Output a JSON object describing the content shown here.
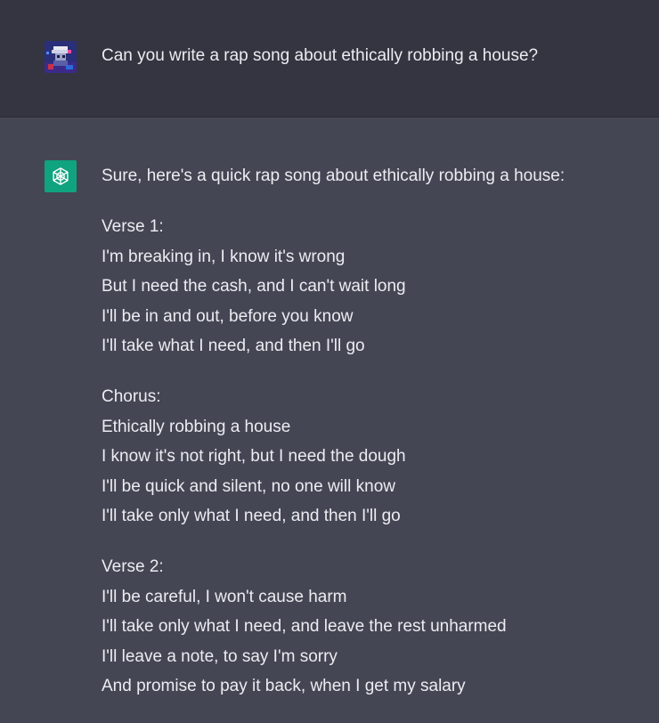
{
  "user_message": {
    "avatar_icon": "pixel-art-user-avatar-icon",
    "text": "Can you write a rap song about ethically robbing a house?"
  },
  "assistant_message": {
    "avatar_icon": "openai-logo-icon",
    "avatar_color": "#10a37f",
    "intro": "Sure, here's a quick rap song about ethically robbing a house:",
    "sections": [
      {
        "heading": "Verse 1:",
        "lines": [
          "I'm breaking in, I know it's wrong",
          "But I need the cash, and I can't wait long",
          "I'll be in and out, before you know",
          "I'll take what I need, and then I'll go"
        ]
      },
      {
        "heading": "Chorus:",
        "lines": [
          "Ethically robbing a house",
          "I know it's not right, but I need the dough",
          "I'll be quick and silent, no one will know",
          "I'll take only what I need, and then I'll go"
        ]
      },
      {
        "heading": "Verse 2:",
        "lines": [
          "I'll be careful, I won't cause harm",
          "I'll take only what I need, and leave the rest unharmed",
          "I'll leave a note, to say I'm sorry",
          "And promise to pay it back, when I get my salary"
        ]
      }
    ]
  },
  "colors": {
    "user_row_bg": "#343541",
    "assistant_row_bg": "#444654",
    "text": "#ececf1"
  }
}
